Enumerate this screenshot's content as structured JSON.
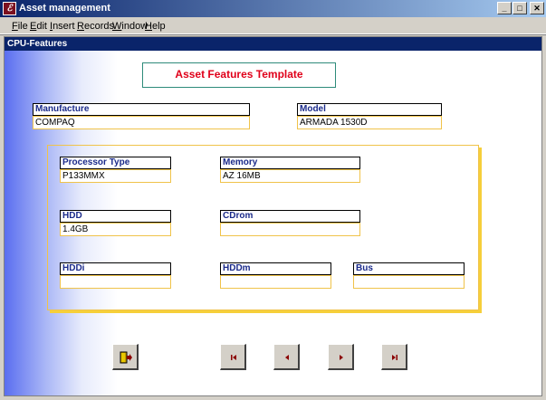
{
  "app": {
    "title": "Asset management",
    "icon": "access-form-icon",
    "window_buttons": [
      "minimize",
      "maximize",
      "close"
    ]
  },
  "menu": {
    "items": [
      "File",
      "Edit",
      "Insert",
      "Records",
      "Window",
      "Help"
    ]
  },
  "form": {
    "window_title": "CPU-Features",
    "header": "Asset Features Template",
    "manufacture": {
      "label": "Manufacture",
      "value": "COMPAQ"
    },
    "model": {
      "label": "Model",
      "value": "ARMADA 1530D"
    },
    "processor_type": {
      "label": "Processor Type",
      "value": "P133MMX"
    },
    "memory": {
      "label": "Memory",
      "value": "AZ 16MB"
    },
    "hdd": {
      "label": "HDD",
      "value": "1.4GB"
    },
    "cdrom": {
      "label": "CDrom",
      "value": ""
    },
    "hddi": {
      "label": "HDDi",
      "value": ""
    },
    "hddm": {
      "label": "HDDm",
      "value": ""
    },
    "bus": {
      "label": "Bus",
      "value": ""
    }
  },
  "nav": {
    "buttons": [
      "exit-form",
      "first-record",
      "previous-record",
      "next-record",
      "last-record"
    ]
  },
  "colors": {
    "title_accent": "#e0001a",
    "label_text": "#1a2a8a",
    "field_border": "#f0c34a",
    "titlebar": "#0a246a"
  }
}
